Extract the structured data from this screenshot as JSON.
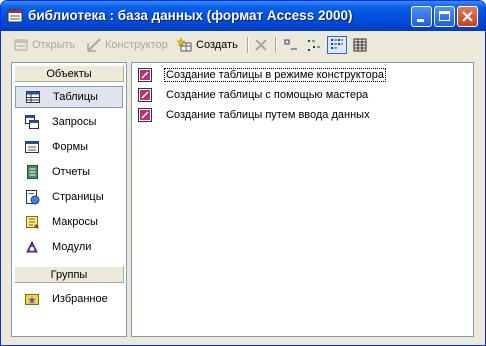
{
  "window": {
    "title": "библиотека : база данных (формат Access 2000)"
  },
  "toolbar": {
    "open_label": "Открыть",
    "designer_label": "Конструктор",
    "create_label": "Создать"
  },
  "left_pane": {
    "objects_header": "Объекты",
    "objects": [
      {
        "label": "Таблицы",
        "icon": "table-icon",
        "selected": true
      },
      {
        "label": "Запросы",
        "icon": "query-icon"
      },
      {
        "label": "Формы",
        "icon": "form-icon"
      },
      {
        "label": "Отчеты",
        "icon": "report-icon"
      },
      {
        "label": "Страницы",
        "icon": "page-icon"
      },
      {
        "label": "Макросы",
        "icon": "macro-icon"
      },
      {
        "label": "Модули",
        "icon": "module-icon"
      }
    ],
    "groups_header": "Группы",
    "groups": [
      {
        "label": "Избранное",
        "icon": "favorites-icon"
      }
    ]
  },
  "right_pane": {
    "items": [
      {
        "label": "Создание таблицы в режиме конструктора"
      },
      {
        "label": "Создание таблицы с помощью мастера"
      },
      {
        "label": "Создание таблицы путем ввода данных"
      }
    ]
  },
  "colors": {
    "titlebar": "#0052e3",
    "selection": "#e0e4ef",
    "pane_border": "#7f9db9"
  }
}
